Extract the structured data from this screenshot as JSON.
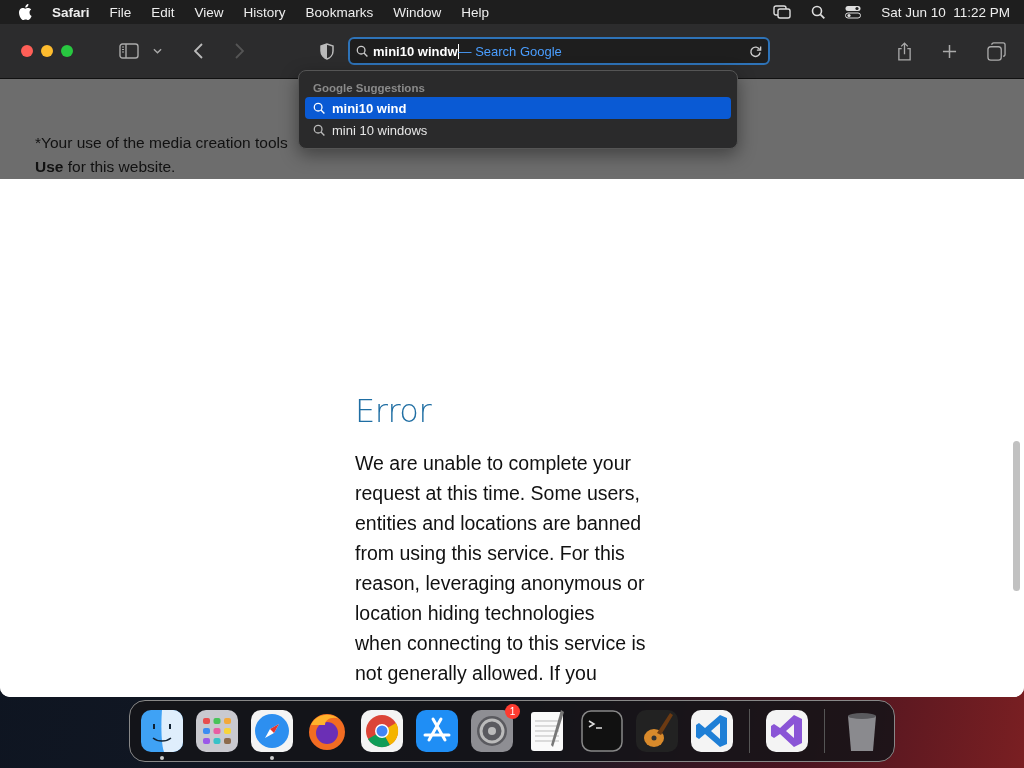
{
  "menu_bar": {
    "app": "Safari",
    "menus": [
      "File",
      "Edit",
      "View",
      "History",
      "Bookmarks",
      "Window",
      "Help"
    ],
    "clock": "Sat Jun 10  11:22 PM"
  },
  "address_bar": {
    "value": "mini10 windw",
    "completion": "— Search Google"
  },
  "suggestions": {
    "heading": "Google Suggestions",
    "items": [
      {
        "label": "mini10 wind",
        "selected": true
      },
      {
        "label": "mini 10 windows",
        "selected": false
      }
    ]
  },
  "page": {
    "notice_lines": [
      "*Your use of the media creation tools",
      "**Use** for this website."
    ],
    "error_title": "Error",
    "error_lines": [
      "We are unable to complete your",
      "request at this time. Some users,",
      "entities and locations are banned",
      "from using this service. For this",
      "reason, leveraging anonymous or",
      "location hiding technologies",
      "when connecting to this service is",
      "not generally allowed. If you"
    ]
  },
  "dock": {
    "items": [
      {
        "kind": "finder",
        "running": true
      },
      {
        "kind": "launchpad",
        "running": false
      },
      {
        "kind": "safari",
        "running": true
      },
      {
        "kind": "firefox",
        "running": false
      },
      {
        "kind": "chrome",
        "running": false
      },
      {
        "kind": "appstore",
        "running": false
      },
      {
        "kind": "settings",
        "running": false,
        "badge": "1"
      },
      {
        "kind": "textedit",
        "running": false
      },
      {
        "kind": "terminal",
        "running": false
      },
      {
        "kind": "garageband",
        "running": false
      },
      {
        "kind": "vscode",
        "running": false
      },
      {
        "kind": "separator"
      },
      {
        "kind": "visualstudio",
        "running": false
      },
      {
        "kind": "separator"
      },
      {
        "kind": "trash",
        "running": false
      }
    ]
  }
}
